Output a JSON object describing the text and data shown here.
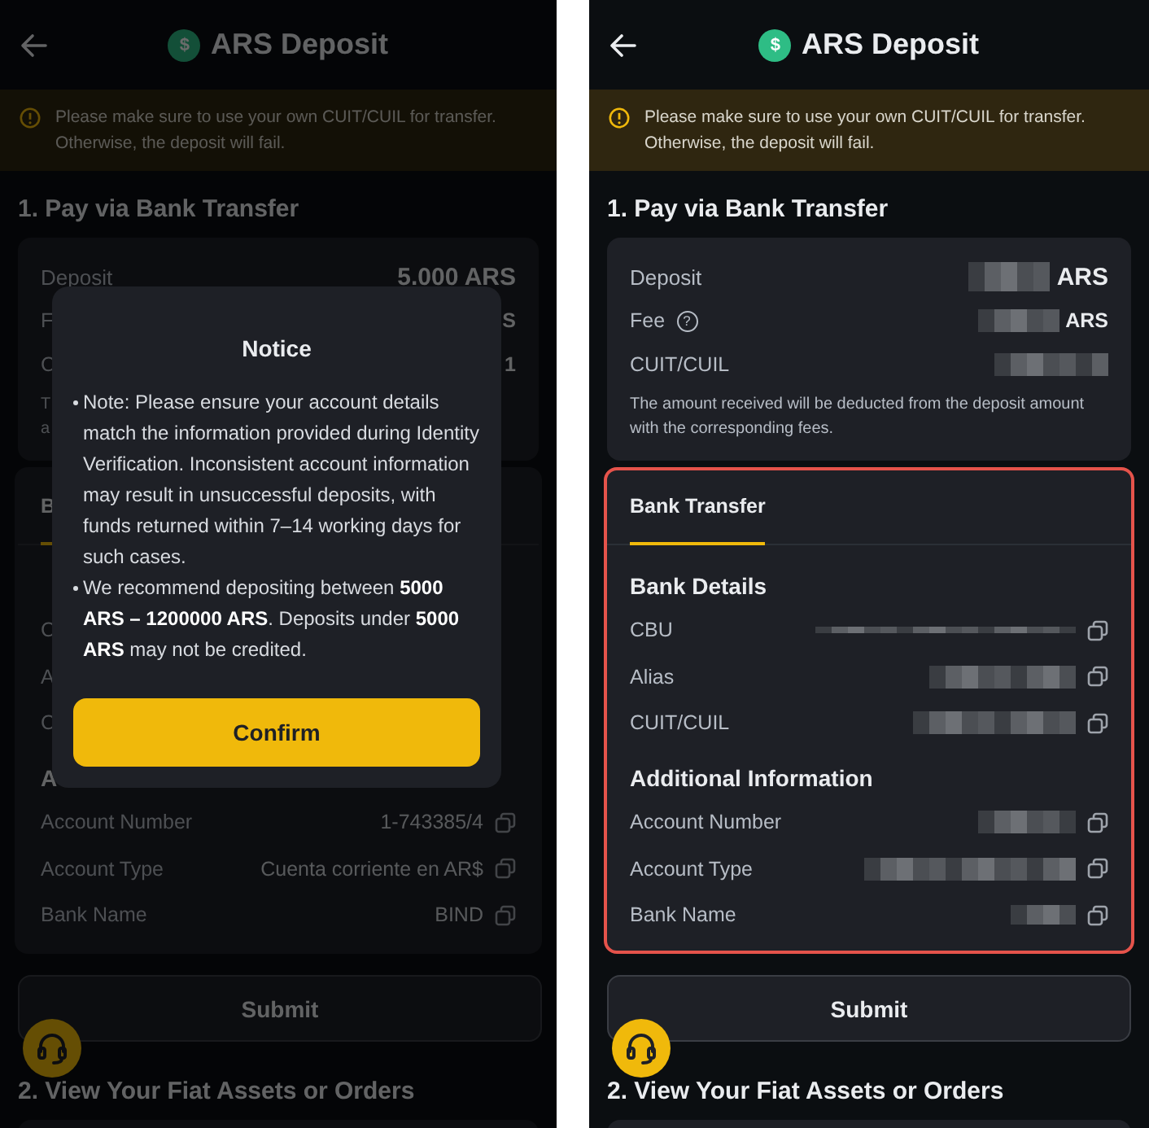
{
  "screens": [
    {
      "dimmed": true,
      "header": {
        "currency_symbol": "$",
        "title": "ARS Deposit"
      },
      "banner": {
        "text": "Please make sure to use your own CUIT/CUIL for transfer. Otherwise, the deposit will fail."
      },
      "section_1": {
        "heading": "1. Pay via Bank Transfer"
      },
      "summary": {
        "rows": [
          {
            "kind": "amount",
            "label": "Deposit",
            "value": "5.000 ARS"
          },
          {
            "kind": "plain",
            "label": "F",
            "value": "S"
          },
          {
            "kind": "plain",
            "label": "C",
            "value": "1"
          }
        ],
        "note": "T\na"
      },
      "details": {
        "outlined": false,
        "tabs": [
          {
            "label": "B",
            "selected": true
          }
        ],
        "groups": [
          {
            "rows": [
              {
                "label": "C"
              },
              {
                "label": "A"
              },
              {
                "label": "C"
              }
            ]
          },
          {
            "heading": "A",
            "rows": [
              {
                "label": "Account Number",
                "value": "1-743385/4",
                "copy": true
              },
              {
                "label": "Account Type",
                "value": "Cuenta corriente en AR$",
                "copy": true
              },
              {
                "label": "Bank Name",
                "value": "BIND",
                "copy": true
              }
            ]
          }
        ]
      },
      "submit": {
        "label": "Submit"
      },
      "section_2": {
        "heading": "2. View Your Fiat Assets or Orders"
      },
      "modal": {
        "title": "Notice",
        "items": [
          "Note: Please ensure your account details match the information provided during Identity Verification. Inconsistent account information may result in unsuccessful deposits, with funds returned within 7–14 working days for such cases.",
          "We recommend depositing between **5000 ARS – 1200000 ARS**. Deposits under **5000 ARS** may not be credited."
        ],
        "confirm": "Confirm"
      }
    },
    {
      "dimmed": false,
      "header": {
        "currency_symbol": "$",
        "title": "ARS Deposit"
      },
      "banner": {
        "text": "Please make sure to use your own CUIT/CUIL for transfer. Otherwise, the deposit will fail."
      },
      "section_1": {
        "heading": "1. Pay via Bank Transfer"
      },
      "summary": {
        "rows": [
          {
            "kind": "amount",
            "label": "Deposit",
            "value": "ARS",
            "redacted": true
          },
          {
            "kind": "plain",
            "label": "Fee",
            "help_icon": "?",
            "value": "ARS",
            "redacted": true
          },
          {
            "kind": "plain",
            "label": "CUIT/CUIL",
            "redacted": true
          }
        ],
        "note": "The amount received will be deducted from the deposit amount with the corresponding fees."
      },
      "details": {
        "outlined": true,
        "tabs": [
          {
            "label": "Bank Transfer",
            "selected": true
          }
        ],
        "groups": [
          {
            "heading": "Bank Details",
            "rows": [
              {
                "label": "CBU",
                "redacted": true,
                "copy": true
              },
              {
                "label": "Alias",
                "redacted": true,
                "copy": true
              },
              {
                "label": "CUIT/CUIL",
                "redacted": true,
                "copy": true
              }
            ]
          },
          {
            "heading": "Additional Information",
            "rows": [
              {
                "label": "Account Number",
                "redacted": true,
                "copy": true
              },
              {
                "label": "Account Type",
                "redacted": true,
                "copy": true
              },
              {
                "label": "Bank Name",
                "redacted": true,
                "copy": true
              }
            ]
          }
        ]
      },
      "submit": {
        "label": "Submit"
      },
      "section_2": {
        "heading": "2. View Your Fiat Assets or Orders"
      }
    }
  ]
}
